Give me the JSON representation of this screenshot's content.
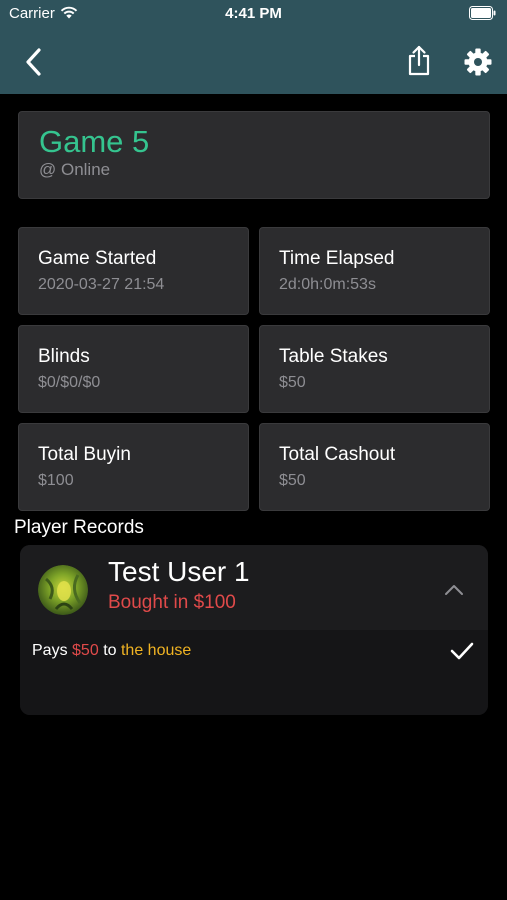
{
  "status_bar": {
    "carrier": "Carrier",
    "time": "4:41 PM"
  },
  "nav": {
    "back_icon": "chevron-left-icon",
    "share_icon": "share-icon",
    "settings_icon": "gear-icon"
  },
  "game": {
    "title": "Game 5",
    "location": "@ Online"
  },
  "stats": {
    "game_started": {
      "label": "Game Started",
      "value": "2020-03-27 21:54"
    },
    "time_elapsed": {
      "label": "Time Elapsed",
      "value": "2d:0h:0m:53s"
    },
    "blinds": {
      "label": "Blinds",
      "value": "$0/$0/$0"
    },
    "table_stakes": {
      "label": "Table Stakes",
      "value": "$50"
    },
    "total_buyin": {
      "label": "Total Buyin",
      "value": "$100"
    },
    "total_cashout": {
      "label": "Total Cashout",
      "value": "$50"
    }
  },
  "player_records": {
    "title": "Player Records",
    "players": [
      {
        "name": "Test User 1",
        "summary": "Bought in $100",
        "payment": {
          "prefix": "Pays",
          "amount": "$50",
          "middle": "to",
          "recipient": "the house"
        }
      }
    ]
  },
  "colors": {
    "nav_bar": "#2f535c",
    "accent_green": "#35c48f",
    "accent_gold": "#f0b323",
    "accent_red": "#e04a4a",
    "card_bg": "#2c2c2e"
  }
}
